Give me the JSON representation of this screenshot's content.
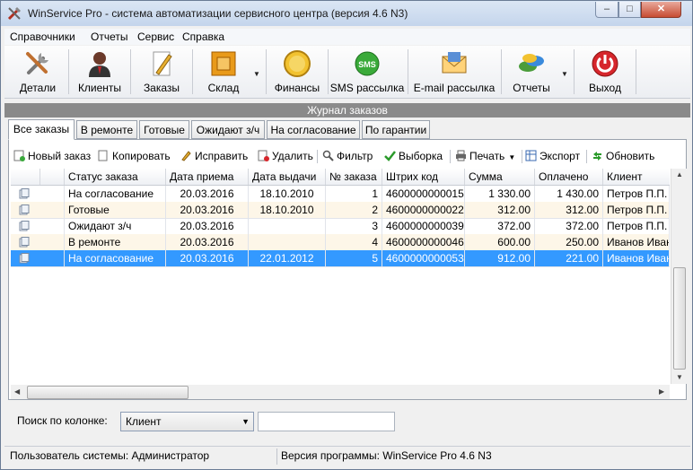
{
  "window": {
    "title": "WinService Pro - система автоматизации сервисного центра (версия 4.6 N3)"
  },
  "menu": [
    "Справочники",
    "Отчеты",
    "Сервис",
    "Справка"
  ],
  "toolbar": [
    {
      "label": "Детали",
      "icon": "tools-icon"
    },
    {
      "label": "Клиенты",
      "icon": "person-icon"
    },
    {
      "label": "Заказы",
      "icon": "pencil-paper-icon"
    },
    {
      "label": "Склад",
      "icon": "box-icon"
    },
    {
      "label": "Финансы",
      "icon": "coin-icon"
    },
    {
      "label": "SMS рассылка",
      "icon": "sms-icon"
    },
    {
      "label": "E-mail рассылка",
      "icon": "envelope-icon"
    },
    {
      "label": "Отчеты",
      "icon": "reports-icon"
    },
    {
      "label": "Выход",
      "icon": "power-icon"
    }
  ],
  "journal_title": "Журнал заказов",
  "tabs": [
    "Все заказы",
    "В ремонте",
    "Готовые",
    "Ожидают з/ч",
    "На согласование",
    "По гарантии"
  ],
  "actions": [
    "Новый заказ",
    "Копировать",
    "Исправить",
    "Удалить",
    "Фильтр",
    "Выборка",
    "Печать",
    "Экспорт",
    "Обновить"
  ],
  "table": {
    "columns": [
      "Статус заказа",
      "Дата приема",
      "Дата выдачи",
      "№ заказа",
      "Штрих код",
      "Сумма",
      "Оплачено",
      "Клиент"
    ],
    "rows": [
      [
        "На согласование",
        "20.03.2016",
        "18.10.2010",
        "1",
        "4600000000015",
        "1 330.00",
        "1 430.00",
        "Петров П.П."
      ],
      [
        "Готовые",
        "20.03.2016",
        "18.10.2010",
        "2",
        "4600000000022",
        "312.00",
        "312.00",
        "Петров П.П."
      ],
      [
        "Ожидают з/ч",
        "20.03.2016",
        "",
        "3",
        "4600000000039",
        "372.00",
        "372.00",
        "Петров П.П."
      ],
      [
        "В ремонте",
        "20.03.2016",
        "",
        "4",
        "4600000000046",
        "600.00",
        "250.00",
        "Иванов Иван"
      ],
      [
        "На согласование",
        "20.03.2016",
        "22.01.2012",
        "5",
        "4600000000053",
        "912.00",
        "221.00",
        "Иванов Иван"
      ]
    ],
    "selected_row": 4
  },
  "search": {
    "label": "Поиск по колонке:",
    "column_value": "Клиент",
    "text_value": ""
  },
  "status": {
    "user": "Пользователь системы: Администратор",
    "version": "Версия программы: WinService Pro 4.6 N3"
  },
  "colors": {
    "selection": "#3399ff",
    "journal_bar": "#8a8a8a",
    "alt_row": "#fdf6e8"
  }
}
